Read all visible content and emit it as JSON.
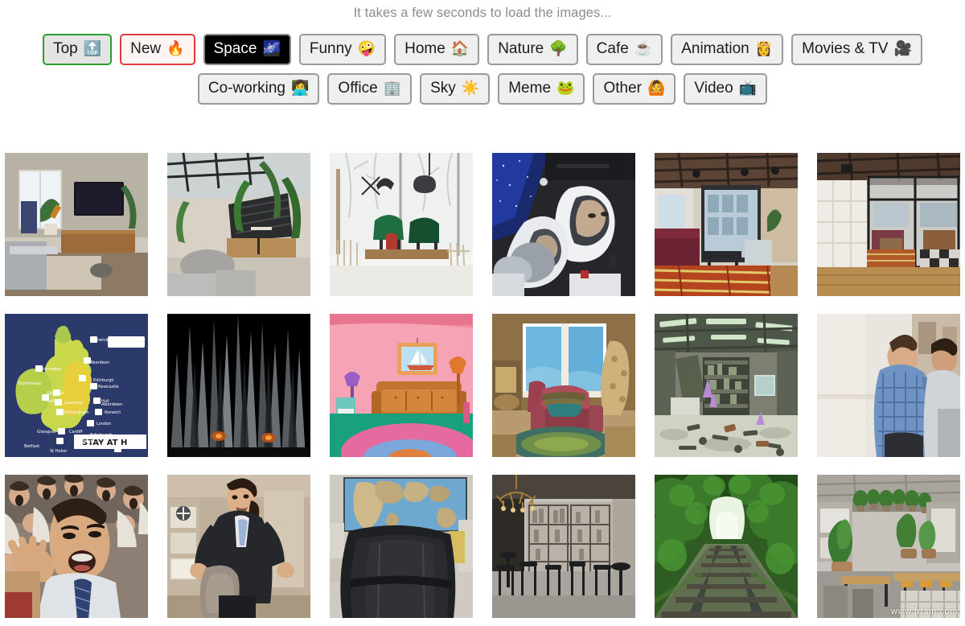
{
  "notice": "It takes a few seconds to load the images...",
  "categories": {
    "row1": [
      {
        "label": "Top",
        "emoji": "🔝",
        "icon_name": "top-arrow-icon",
        "state": "selected-green"
      },
      {
        "label": "New",
        "emoji": "🔥",
        "icon_name": "fire-icon",
        "state": "selected-red"
      },
      {
        "label": "Space",
        "emoji": "🌌",
        "icon_name": "milky-way-icon",
        "state": "active-dark"
      },
      {
        "label": "Funny",
        "emoji": "🤪",
        "icon_name": "zany-face-icon",
        "state": "default"
      },
      {
        "label": "Home",
        "emoji": "🏠",
        "icon_name": "house-icon",
        "state": "default"
      },
      {
        "label": "Nature",
        "emoji": "🌳",
        "icon_name": "tree-icon",
        "state": "default"
      },
      {
        "label": "Cafe",
        "emoji": "☕",
        "icon_name": "coffee-cup-icon",
        "state": "default"
      },
      {
        "label": "Animation",
        "emoji": "👸",
        "icon_name": "princess-icon",
        "state": "default"
      },
      {
        "label": "Movies & TV",
        "emoji": "🎥",
        "icon_name": "movie-camera-icon",
        "state": "default"
      }
    ],
    "row2": [
      {
        "label": "Co-working",
        "emoji": "👩‍💻",
        "icon_name": "woman-technologist-icon",
        "state": "default"
      },
      {
        "label": "Office",
        "emoji": "🏢",
        "icon_name": "office-building-icon",
        "state": "default"
      },
      {
        "label": "Sky",
        "emoji": "☀️",
        "icon_name": "sun-icon",
        "state": "default"
      },
      {
        "label": "Meme",
        "emoji": "🐸",
        "icon_name": "frog-icon",
        "state": "default"
      },
      {
        "label": "Other",
        "emoji": "🙆",
        "icon_name": "person-gesturing-ok-icon",
        "state": "default"
      },
      {
        "label": "Video",
        "emoji": "📺",
        "icon_name": "television-icon",
        "state": "default"
      }
    ]
  },
  "colors": {
    "selected_green": "#2ca02c",
    "selected_red": "#e33b3b",
    "active_dark_bg": "#000000",
    "chip_bg": "#efefef",
    "chip_border": "#9a9a9a",
    "notice_text": "#8c8c8c"
  },
  "grid": {
    "columns": 6,
    "rows": 3,
    "thumb_size_px": 178,
    "items": [
      {
        "row": 1,
        "col": 1,
        "name": "living-room-tv-cat",
        "alt": "Living room with wall TV, wooden sideboard and cat on rug"
      },
      {
        "row": 1,
        "col": 2,
        "name": "loft-plants-lounge",
        "alt": "Loft lounge with black steel pergola and tall green plants"
      },
      {
        "row": 1,
        "col": 3,
        "name": "winter-window-green-chairs",
        "alt": "Bright room with green velvet chairs facing snowy window"
      },
      {
        "row": 1,
        "col": 4,
        "name": "astronauts-capsule",
        "alt": "Two astronauts in white spacesuits inside a crew capsule"
      },
      {
        "row": 1,
        "col": 5,
        "name": "coworking-lounge-red-rug",
        "alt": "Industrial co-working lounge with red striped rug"
      },
      {
        "row": 1,
        "col": 6,
        "name": "glass-partition-office",
        "alt": "Office with black framed glass partition and wood floor"
      },
      {
        "row": 2,
        "col": 1,
        "name": "uk-weather-map",
        "alt": "UK weather map with city temperatures and STAY AT HOME banner"
      },
      {
        "row": 2,
        "col": 2,
        "name": "iron-throne",
        "alt": "Iron Throne of swords in darkness"
      },
      {
        "row": 2,
        "col": 3,
        "name": "cartoon-couch-livingroom",
        "alt": "Cartoon pink living room with orange couch and sailboat painting"
      },
      {
        "row": 2,
        "col": 4,
        "name": "animated-armchair-window",
        "alt": "Animated cosy room with pink armchair by bay window"
      },
      {
        "row": 2,
        "col": 5,
        "name": "animated-cluttered-workshop",
        "alt": "Animated cluttered workshop with shelves and crystals"
      },
      {
        "row": 2,
        "col": 6,
        "name": "distracted-boyfriend-meme",
        "alt": "Distracted boyfriend meme street photo"
      },
      {
        "row": 3,
        "col": 1,
        "name": "wolf-of-wall-street-shout",
        "alt": "Shouting man in suit and tie in front of a crowd"
      },
      {
        "row": 3,
        "col": 2,
        "name": "confused-travolta",
        "alt": "Confused man in black suit holding a coat"
      },
      {
        "row": 3,
        "col": 3,
        "name": "office-chair-world-map",
        "alt": "Black office chair in front of a world map"
      },
      {
        "row": 3,
        "col": 4,
        "name": "restaurant-bar-chandelier",
        "alt": "Restaurant interior with antler chandelier and black stools"
      },
      {
        "row": 3,
        "col": 5,
        "name": "green-railway-tunnel",
        "alt": "Railway track through a tunnel of green trees"
      },
      {
        "row": 3,
        "col": 6,
        "name": "plant-filled-cafe",
        "alt": "Cafe with long counter, wooden tables and many plants"
      }
    ]
  },
  "watermark": "www.frfam.com"
}
